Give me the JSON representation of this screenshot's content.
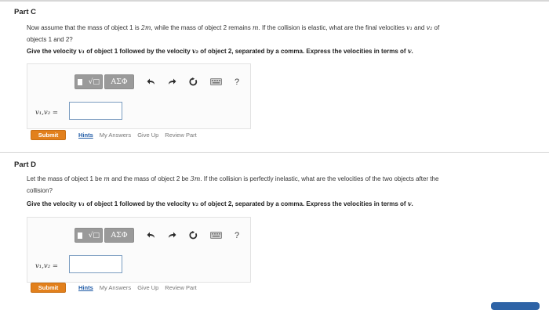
{
  "partC": {
    "title": "Part C",
    "question": {
      "pre": "Now assume that the mass of object 1 is ",
      "m1": "2m",
      "mid": ", while the mass of object 2 remains ",
      "m2": "m",
      "post": ". If the collision is elastic, what are the final velocities ",
      "v1": "v₁",
      "and": " and ",
      "v2": "v₂",
      "tail": " of",
      "line2": "objects 1 and 2?"
    },
    "instruction": {
      "a": "Give the velocity ",
      "v1": "v₁",
      "b": " of object 1 followed by the velocity ",
      "v2": "v₂",
      "c": " of object 2, separated by a comma. Express the velocities in terms of ",
      "v": "v",
      "d": "."
    },
    "answer_label": "v₁,v₂ =",
    "answer_value": ""
  },
  "partD": {
    "title": "Part D",
    "question": {
      "pre": "Let the mass of object 1 be ",
      "m1": "m",
      "mid": " and the mass of object 2 be ",
      "m2": "3m",
      "post": ". If the collision is perfectly inelastic, what are the velocities of the two objects after the",
      "line2": "collision?"
    },
    "instruction": {
      "a": "Give the velocity ",
      "v1": "v₁",
      "b": " of object 1 followed by the velocity ",
      "v2": "v₂",
      "c": " of object 2, separated by a comma. Express the velocities in terms of ",
      "v": "v",
      "d": "."
    },
    "answer_label": "v₁,v₂ =",
    "answer_value": ""
  },
  "toolbar": {
    "template_glyph": "√□",
    "greek_label": "ΑΣΦ",
    "help": "?",
    "icons": [
      "template-icon",
      "greek-symbols-icon",
      "undo-icon",
      "redo-icon",
      "reset-icon",
      "keyboard-icon",
      "help-icon"
    ]
  },
  "actions": {
    "submit": "Submit",
    "hints": "Hints",
    "my_answers": "My Answers",
    "give_up": "Give Up",
    "review_part": "Review Part"
  },
  "colors": {
    "submit_bg": "#e2801c",
    "hints_link": "#1f5aa6",
    "toolbar_button": "#9a9a9a",
    "input_border": "#7a9cc0"
  }
}
